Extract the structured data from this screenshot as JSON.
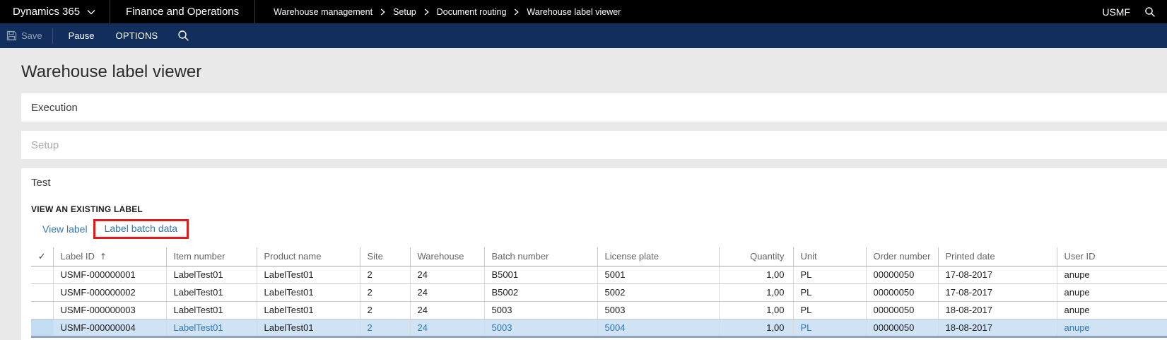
{
  "topbar": {
    "app_name": "Dynamics 365",
    "product_name": "Finance and Operations",
    "breadcrumb": [
      "Warehouse management",
      "Setup",
      "Document routing",
      "Warehouse label viewer"
    ],
    "company": "USMF"
  },
  "commandbar": {
    "save_label": "Save",
    "pause_label": "Pause",
    "options_label": "OPTIONS"
  },
  "page": {
    "title": "Warehouse label viewer"
  },
  "sections": {
    "execution_label": "Execution",
    "setup_label": "Setup",
    "test_label": "Test"
  },
  "test": {
    "group_label": "VIEW AN EXISTING LABEL",
    "view_label_link": "View label",
    "label_batch_data_link": "Label batch data"
  },
  "grid": {
    "icons": {
      "select_all": "✓",
      "sort_ascending": "↑"
    },
    "sorted_column": "Label ID",
    "columns": [
      "Label ID",
      "Item number",
      "Product name",
      "Site",
      "Warehouse",
      "Batch number",
      "License plate",
      "Quantity",
      "Unit",
      "Order number",
      "Printed date",
      "User ID"
    ],
    "rows": [
      {
        "selected": false,
        "cells": [
          "USMF-000000001",
          "LabelTest01",
          "LabelTest01",
          "2",
          "24",
          "B5001",
          "5001",
          "1,00",
          "PL",
          "00000050",
          "17-08-2017",
          "anupe"
        ]
      },
      {
        "selected": false,
        "cells": [
          "USMF-000000002",
          "LabelTest01",
          "LabelTest01",
          "2",
          "24",
          "B5002",
          "5002",
          "1,00",
          "PL",
          "00000050",
          "17-08-2017",
          "anupe"
        ]
      },
      {
        "selected": false,
        "cells": [
          "USMF-000000003",
          "LabelTest01",
          "LabelTest01",
          "2",
          "24",
          "5003",
          "5003",
          "1,00",
          "PL",
          "00000050",
          "18-08-2017",
          "anupe"
        ]
      },
      {
        "selected": true,
        "cells": [
          "USMF-000000004",
          "LabelTest01",
          "LabelTest01",
          "2",
          "24",
          "5003",
          "5004",
          "1,00",
          "PL",
          "00000050",
          "18-08-2017",
          "anupe"
        ]
      }
    ]
  },
  "colors": {
    "commandbar_bg": "#122e5c",
    "link_blue": "#2e75b5",
    "selected_row_bg": "#cfe3f5",
    "annotation_red": "#e01b1b"
  }
}
